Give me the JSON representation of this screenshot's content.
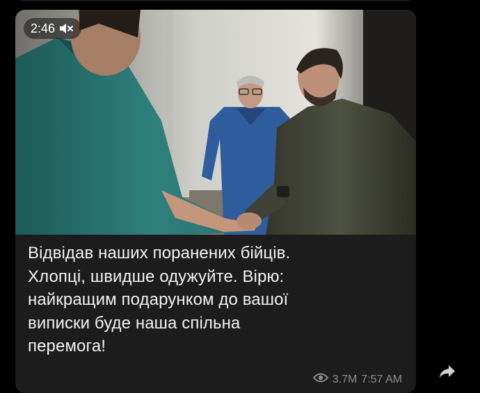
{
  "post": {
    "video_duration": "2:46",
    "caption_lines": [
      "Відвідав наших поранених бійців.",
      "Хлопці, швидше одужуйте. Вірю:",
      "найкращим подарунком до вашої",
      "виписки буде наша спільна",
      "перемога!"
    ],
    "views": "3.7M",
    "time": "7:57 AM"
  },
  "icons": {
    "mute": "speaker-muted-icon",
    "views": "eye-icon",
    "share": "share-arrow-icon"
  },
  "colors": {
    "background": "#000000",
    "bubble": "#1c1c1d",
    "text": "#f2f2f2",
    "meta": "#8d8d92"
  }
}
